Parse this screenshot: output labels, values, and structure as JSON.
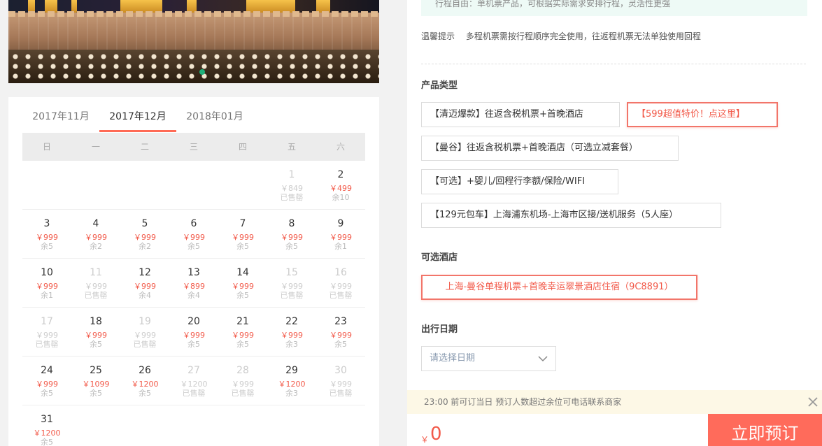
{
  "top_note": "行程自由：单机票产品，可根据实际需求安排行程，灵活性更强",
  "tips": {
    "label": "温馨提示",
    "text": "多程机票需按行程顺序完全使用，往返程机票无法单独使用回程"
  },
  "months": [
    {
      "label": "2017年11月",
      "active": false
    },
    {
      "label": "2017年12月",
      "active": true
    },
    {
      "label": "2018年01月",
      "active": false
    }
  ],
  "weekdays": [
    "日",
    "一",
    "二",
    "三",
    "四",
    "五",
    "六"
  ],
  "calendar_weeks": [
    [
      null,
      null,
      null,
      null,
      null,
      {
        "day": "1",
        "price": "￥849",
        "stock": "已售罄",
        "available": false
      },
      {
        "day": "2",
        "price": "￥499",
        "stock": "余10",
        "available": true
      }
    ],
    [
      {
        "day": "3",
        "price": "￥999",
        "stock": "余5",
        "available": true
      },
      {
        "day": "4",
        "price": "￥999",
        "stock": "余2",
        "available": true
      },
      {
        "day": "5",
        "price": "￥999",
        "stock": "余2",
        "available": true
      },
      {
        "day": "6",
        "price": "￥999",
        "stock": "余5",
        "available": true
      },
      {
        "day": "7",
        "price": "￥999",
        "stock": "余5",
        "available": true
      },
      {
        "day": "8",
        "price": "￥999",
        "stock": "余5",
        "available": true
      },
      {
        "day": "9",
        "price": "￥999",
        "stock": "余1",
        "available": true
      }
    ],
    [
      {
        "day": "10",
        "price": "￥999",
        "stock": "余1",
        "available": true
      },
      {
        "day": "11",
        "price": "￥999",
        "stock": "已售罄",
        "available": false
      },
      {
        "day": "12",
        "price": "￥999",
        "stock": "余4",
        "available": true
      },
      {
        "day": "13",
        "price": "￥899",
        "stock": "余4",
        "available": true
      },
      {
        "day": "14",
        "price": "￥999",
        "stock": "余5",
        "available": true
      },
      {
        "day": "15",
        "price": "￥999",
        "stock": "已售罄",
        "available": false
      },
      {
        "day": "16",
        "price": "￥999",
        "stock": "已售罄",
        "available": false
      }
    ],
    [
      {
        "day": "17",
        "price": "￥999",
        "stock": "已售罄",
        "available": false
      },
      {
        "day": "18",
        "price": "￥999",
        "stock": "余5",
        "available": true
      },
      {
        "day": "19",
        "price": "￥999",
        "stock": "已售罄",
        "available": false
      },
      {
        "day": "20",
        "price": "￥999",
        "stock": "余5",
        "available": true
      },
      {
        "day": "21",
        "price": "￥999",
        "stock": "余5",
        "available": true
      },
      {
        "day": "22",
        "price": "￥999",
        "stock": "余3",
        "available": true
      },
      {
        "day": "23",
        "price": "￥999",
        "stock": "余5",
        "available": true
      }
    ],
    [
      {
        "day": "24",
        "price": "￥999",
        "stock": "余5",
        "available": true
      },
      {
        "day": "25",
        "price": "￥1099",
        "stock": "余5",
        "available": true
      },
      {
        "day": "26",
        "price": "￥1200",
        "stock": "余5",
        "available": true
      },
      {
        "day": "27",
        "price": "￥1200",
        "stock": "已售罄",
        "available": false
      },
      {
        "day": "28",
        "price": "￥999",
        "stock": "已售罄",
        "available": false
      },
      {
        "day": "29",
        "price": "￥1200",
        "stock": "余3",
        "available": true
      },
      {
        "day": "30",
        "price": "￥999",
        "stock": "已售罄",
        "available": false
      }
    ],
    [
      {
        "day": "31",
        "price": "￥1200",
        "stock": "余5",
        "available": true
      },
      null,
      null,
      null,
      null,
      null,
      null
    ]
  ],
  "product_type": {
    "title": "产品类型",
    "options": [
      {
        "label": "【清迈爆款】往返含税机票+首晚酒店",
        "highlight": false
      },
      {
        "label": "【599超值特价！点这里】",
        "highlight": true
      },
      {
        "label": "【曼谷】往返含税机票+首晚酒店（可选立减套餐）",
        "highlight": false
      },
      {
        "label": "【可选】+婴儿/回程行李额/保险/WIFI",
        "highlight": false
      },
      {
        "label": "【129元包车】上海浦东机场-上海市区接/送机服务（5人座）",
        "highlight": false
      }
    ]
  },
  "hotel": {
    "title": "可选酒店",
    "option": "上海-曼谷单程机票+首晚幸运翠景酒店住宿（9C8891）"
  },
  "date_select": {
    "title": "出行日期",
    "placeholder": "请选择日期"
  },
  "notice": "23:00 前可订当日 预订人数超过余位可电话联系商家",
  "price": {
    "currency": "￥",
    "amount": "0"
  },
  "book_button": "立即预订",
  "colors": {
    "accent": "#ff6b5b",
    "price": "#f25a4a",
    "slide_dot": "#1fb07a"
  }
}
